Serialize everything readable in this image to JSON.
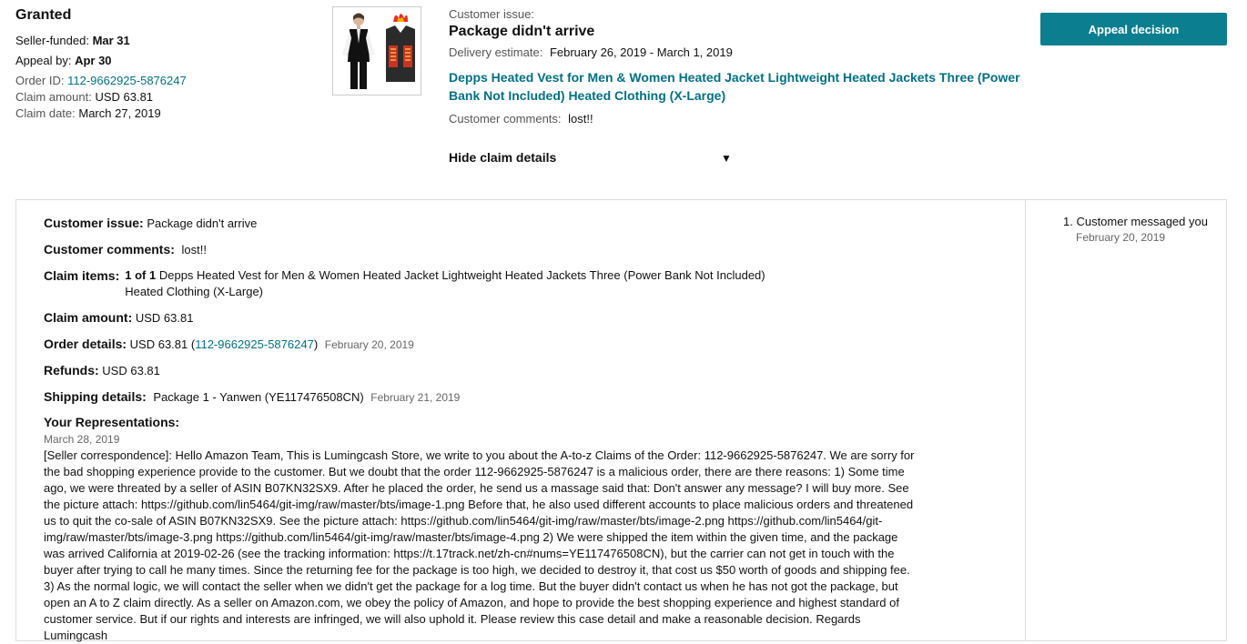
{
  "summary": {
    "status": "Granted",
    "seller_funded_label": "Seller-funded:",
    "seller_funded_value": "Mar 31",
    "appeal_by_label": "Appeal by:",
    "appeal_by_value": "Apr 30",
    "order_id_label": "Order ID:",
    "order_id_value": "112-9662925-5876247",
    "claim_amount_label": "Claim amount:",
    "claim_amount_value": "USD 63.81",
    "claim_date_label": "Claim date:",
    "claim_date_value": "March 27, 2019"
  },
  "claim": {
    "issue_label": "Customer issue:",
    "issue_value": "Package didn't arrive",
    "delivery_label": "Delivery estimate:",
    "delivery_value": "February 26, 2019 - March 1, 2019",
    "product_title": "Depps Heated Vest for Men & Women Heated Jacket Lightweight Heated Jackets Three (Power Bank Not Included) Heated Clothing (X-Large)",
    "comments_label": "Customer comments:",
    "comments_value": "lost!!",
    "hide_details_label": "Hide claim details"
  },
  "actions": {
    "appeal_label": "Appeal decision"
  },
  "details": {
    "issue_label": "Customer issue:",
    "issue_value": "Package didn't arrive",
    "comments_label": "Customer comments:",
    "comments_value": "lost!!",
    "items_label": "Claim items:",
    "items_count": "1 of 1",
    "items_value_line1": "Depps Heated Vest for Men & Women Heated Jacket Lightweight Heated Jackets Three (Power Bank Not Included)",
    "items_value_line2": "Heated Clothing (X-Large)",
    "amount_label": "Claim amount:",
    "amount_value": "USD 63.81",
    "order_label": "Order details:",
    "order_amount": "USD 63.81 (",
    "order_id": "112-9662925-5876247",
    "order_close": ")",
    "order_date": "February 20, 2019",
    "refunds_label": "Refunds:",
    "refunds_value": "USD 63.81",
    "shipping_label": "Shipping details:",
    "shipping_value": "Package 1 - Yanwen (YE117476508CN)",
    "shipping_date": "February 21, 2019",
    "rep_label": "Your Representations:",
    "rep_date": "March 28, 2019",
    "rep_text": "[Seller correspondence]: Hello Amazon Team, This is Lumingcash Store, we write to you about the A-to-z Claims of the Order: 112-9662925-5876247. We are sorry for the bad shopping experience provide to the customer. But we doubt that the order 112-9662925-5876247 is a malicious order, there are there reasons: 1) Some time ago, we were threated by a seller of ASIN B07KN32SX9. After he placed the order, he send us a massage said that: Don't answer any message? I will buy more. See the picture attach: https://github.com/lin5464/git-img/raw/master/bts/image-1.png Before that, he also used different accounts to place malicious orders and threatened us to quit the co-sale of ASIN B07KN32SX9. See the picture attach: https://github.com/lin5464/git-img/raw/master/bts/image-2.png https://github.com/lin5464/git-img/raw/master/bts/image-3.png https://github.com/lin5464/git-img/raw/master/bts/image-4.png 2) We were shipped the item within the given time, and the package was arrived California at 2019-02-26 (see the tracking information: https://t.17track.net/zh-cn#nums=YE117476508CN), but the carrier can not get in touch with the buyer after trying to call he many times. Since the returning fee for the package is too high, we decided to destroy it, that cost us $50 worth of goods and shipping fee. 3) As the normal logic, we will contact the seller when we didn't get the package for a log time. But the buyer didn't contact us when he has not got the package, but open an A to Z claim directly. As a seller on Amazon.com, we obey the policy of Amazon, and hope to provide the best shopping experience and highest standard of customer service. But if our rights and interests are infringed, we will also uphold it. Please review this case detail and make a reasonable decision. Regards Lumingcash"
  },
  "timeline": {
    "item1_label": "1. Customer messaged you",
    "item1_date": "February 20, 2019"
  }
}
